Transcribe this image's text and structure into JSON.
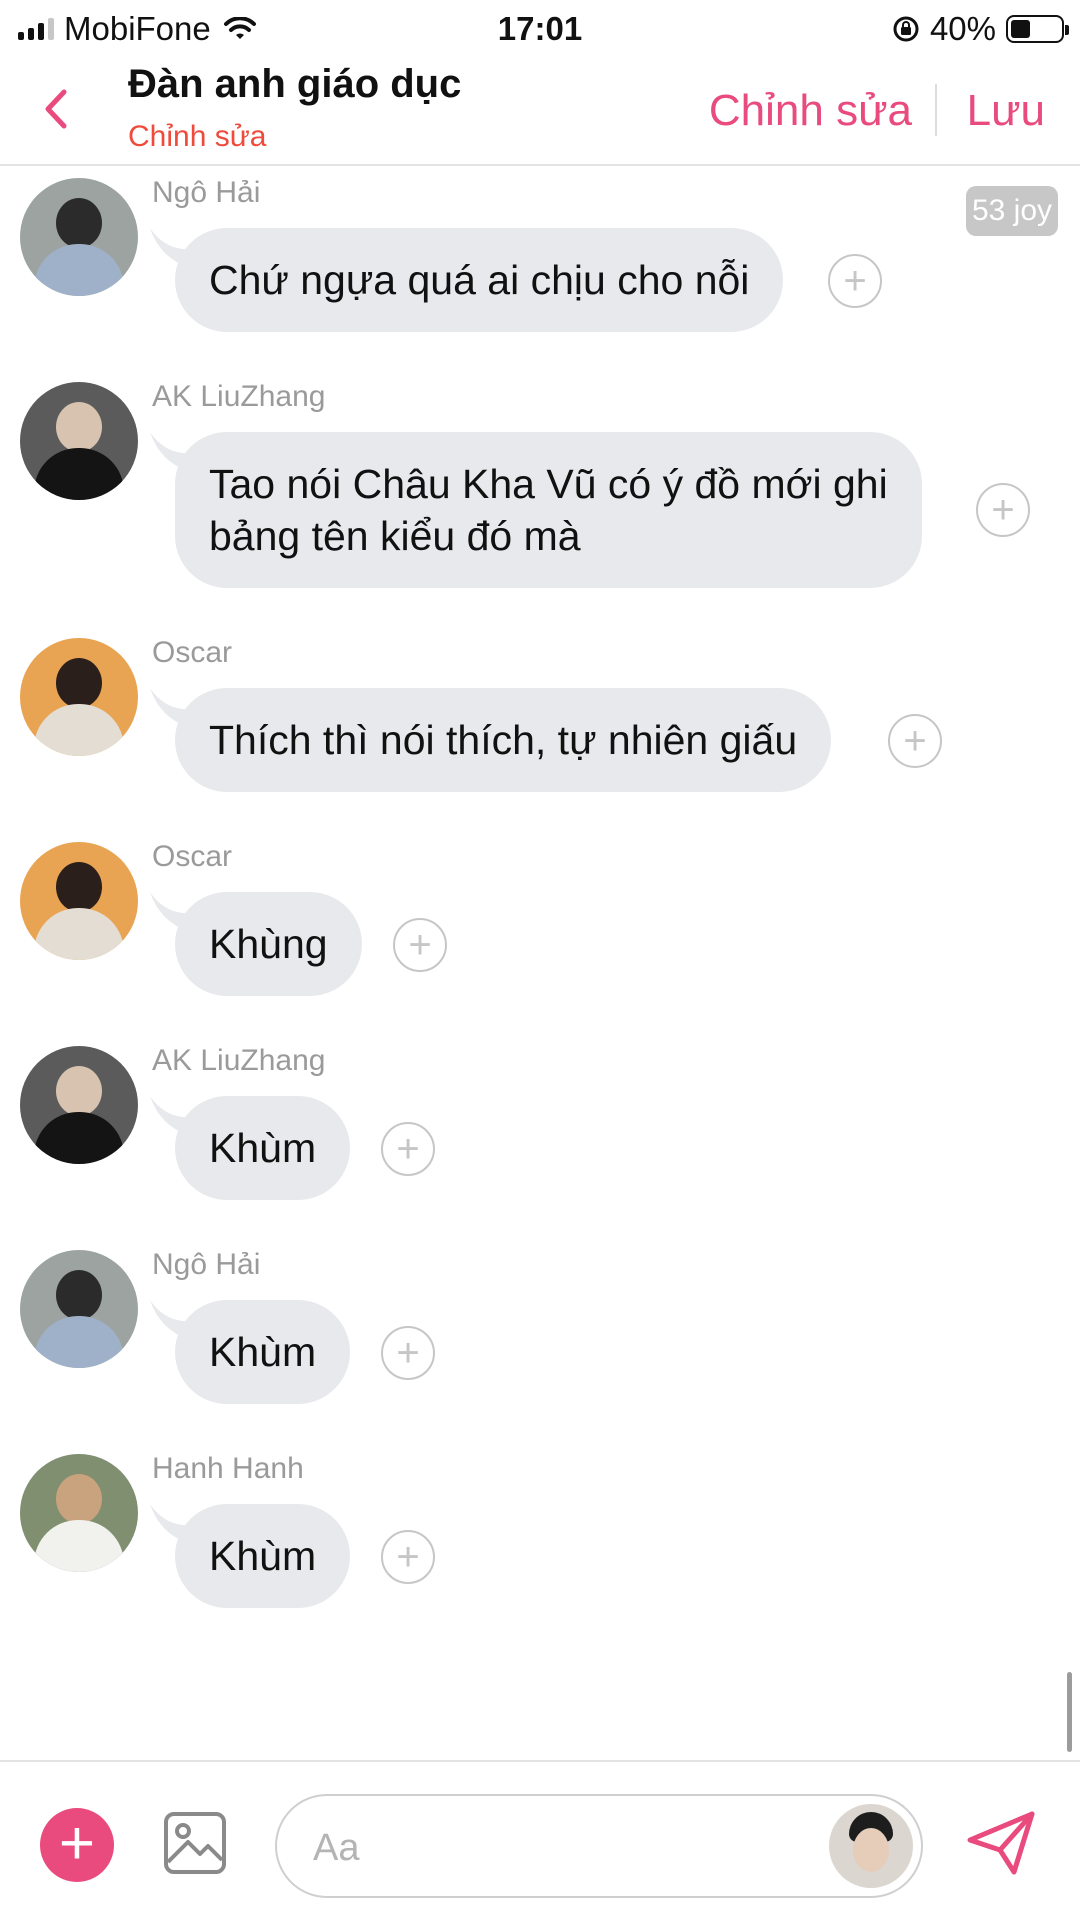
{
  "status_bar": {
    "carrier": "MobiFone",
    "time": "17:01",
    "battery_percent": "40%",
    "battery_level": 0.4
  },
  "nav": {
    "title": "Đàn anh giáo dục",
    "subtitle": "Chỉnh sửa",
    "edit_label": "Chỉnh sửa",
    "save_label": "Lưu",
    "accent_color": "#e94b7e"
  },
  "joy_badge": "53 joy",
  "messages": [
    {
      "sender": "Ngô Hải",
      "text": "Chứ ngựa quá ai chịu cho nỗi",
      "avatar": "hoodie-gray"
    },
    {
      "sender": "AK LiuZhang",
      "text_line1": "Tao nói Châu Kha Vũ có ý đồ mới ghi",
      "text_line2": "bảng tên kiểu đó mà",
      "avatar": "black-shirt"
    },
    {
      "sender": "Oscar",
      "text": "Thích thì nói thích, tự nhiên giấu",
      "avatar": "orange-bg"
    },
    {
      "sender": "Oscar",
      "text": "Khùng",
      "avatar": "orange-bg"
    },
    {
      "sender": "AK LiuZhang",
      "text": "Khùm",
      "avatar": "black-shirt"
    },
    {
      "sender": "Ngô Hải",
      "text": "Khùm",
      "avatar": "hoodie-gray"
    },
    {
      "sender": "Hanh Hanh",
      "text": "Khùm",
      "avatar": "white-outfit"
    }
  ],
  "reaction_symbol": "+",
  "composer": {
    "placeholder": "Aa",
    "plus_symbol": "+"
  }
}
